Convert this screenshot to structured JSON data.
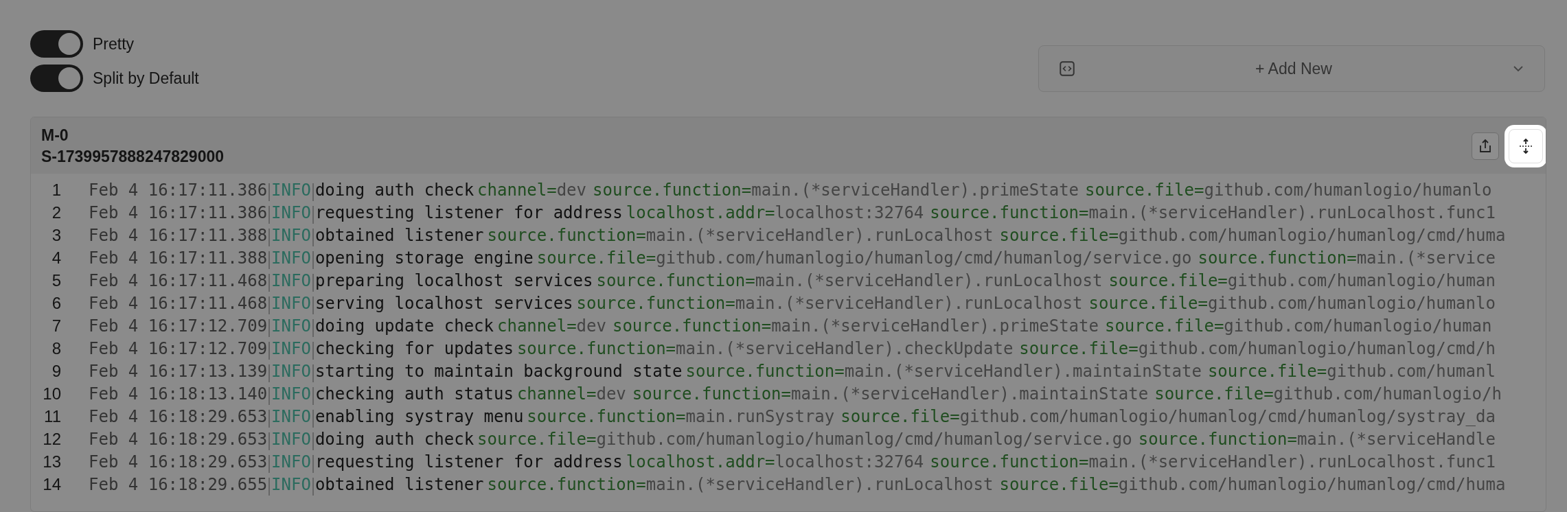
{
  "toggles": [
    {
      "label": "Pretty",
      "on": true
    },
    {
      "label": "Split by Default",
      "on": true
    }
  ],
  "add_new": {
    "label": "+ Add New"
  },
  "panel": {
    "title": "M-0",
    "subtitle": "S-1739957888247829000",
    "buttons": [
      {
        "kind": "share",
        "highlighted": false
      },
      {
        "kind": "expand",
        "highlighted": true
      }
    ],
    "rows": [
      {
        "line": "1",
        "timestamp": "Feb 4 16:17:11.386",
        "level": "INFO",
        "message": "doing auth check",
        "fields": [
          {
            "key": "channel=",
            "value": "dev"
          },
          {
            "key": "source.function=",
            "value": "main.(*serviceHandler).primeState"
          },
          {
            "key": "source.file=",
            "value": "github.com/humanlogio/humanlo"
          }
        ]
      },
      {
        "line": "2",
        "timestamp": "Feb 4 16:17:11.386",
        "level": "INFO",
        "message": "requesting listener for address",
        "fields": [
          {
            "key": "localhost.addr=",
            "value": "localhost:32764"
          },
          {
            "key": "source.function=",
            "value": "main.(*serviceHandler).runLocalhost.func1"
          }
        ]
      },
      {
        "line": "3",
        "timestamp": "Feb 4 16:17:11.388",
        "level": "INFO",
        "message": "obtained listener",
        "fields": [
          {
            "key": "source.function=",
            "value": "main.(*serviceHandler).runLocalhost"
          },
          {
            "key": "source.file=",
            "value": "github.com/humanlogio/humanlog/cmd/huma"
          }
        ]
      },
      {
        "line": "4",
        "timestamp": "Feb 4 16:17:11.388",
        "level": "INFO",
        "message": "opening storage engine",
        "fields": [
          {
            "key": "source.file=",
            "value": "github.com/humanlogio/humanlog/cmd/humanlog/service.go"
          },
          {
            "key": "source.function=",
            "value": "main.(*service"
          }
        ]
      },
      {
        "line": "5",
        "timestamp": "Feb 4 16:17:11.468",
        "level": "INFO",
        "message": "preparing localhost services",
        "fields": [
          {
            "key": "source.function=",
            "value": "main.(*serviceHandler).runLocalhost"
          },
          {
            "key": "source.file=",
            "value": "github.com/humanlogio/human"
          }
        ]
      },
      {
        "line": "6",
        "timestamp": "Feb 4 16:17:11.468",
        "level": "INFO",
        "message": "serving localhost services",
        "fields": [
          {
            "key": "source.function=",
            "value": "main.(*serviceHandler).runLocalhost"
          },
          {
            "key": "source.file=",
            "value": "github.com/humanlogio/humanlo"
          }
        ]
      },
      {
        "line": "7",
        "timestamp": "Feb 4 16:17:12.709",
        "level": "INFO",
        "message": "doing update check",
        "fields": [
          {
            "key": "channel=",
            "value": "dev"
          },
          {
            "key": "source.function=",
            "value": "main.(*serviceHandler).primeState"
          },
          {
            "key": "source.file=",
            "value": "github.com/humanlogio/human"
          }
        ]
      },
      {
        "line": "8",
        "timestamp": "Feb 4 16:17:12.709",
        "level": "INFO",
        "message": "checking for updates",
        "fields": [
          {
            "key": "source.function=",
            "value": "main.(*serviceHandler).checkUpdate"
          },
          {
            "key": "source.file=",
            "value": "github.com/humanlogio/humanlog/cmd/h"
          }
        ]
      },
      {
        "line": "9",
        "timestamp": "Feb 4 16:17:13.139",
        "level": "INFO",
        "message": "starting to maintain background state",
        "fields": [
          {
            "key": "source.function=",
            "value": "main.(*serviceHandler).maintainState"
          },
          {
            "key": "source.file=",
            "value": "github.com/humanl"
          }
        ]
      },
      {
        "line": "10",
        "timestamp": "Feb 4 16:18:13.140",
        "level": "INFO",
        "message": "checking auth status",
        "fields": [
          {
            "key": "channel=",
            "value": "dev"
          },
          {
            "key": "source.function=",
            "value": "main.(*serviceHandler).maintainState"
          },
          {
            "key": "source.file=",
            "value": "github.com/humanlogio/h"
          }
        ]
      },
      {
        "line": "11",
        "timestamp": "Feb 4 16:18:29.653",
        "level": "INFO",
        "message": "enabling systray menu",
        "fields": [
          {
            "key": "source.function=",
            "value": "main.runSystray"
          },
          {
            "key": "source.file=",
            "value": "github.com/humanlogio/humanlog/cmd/humanlog/systray_da"
          }
        ]
      },
      {
        "line": "12",
        "timestamp": "Feb 4 16:18:29.653",
        "level": "INFO",
        "message": "doing auth check",
        "fields": [
          {
            "key": "source.file=",
            "value": "github.com/humanlogio/humanlog/cmd/humanlog/service.go"
          },
          {
            "key": "source.function=",
            "value": "main.(*serviceHandle"
          }
        ]
      },
      {
        "line": "13",
        "timestamp": "Feb 4 16:18:29.653",
        "level": "INFO",
        "message": "requesting listener for address",
        "fields": [
          {
            "key": "localhost.addr=",
            "value": "localhost:32764"
          },
          {
            "key": "source.function=",
            "value": "main.(*serviceHandler).runLocalhost.func1"
          }
        ]
      },
      {
        "line": "14",
        "timestamp": "Feb 4 16:18:29.655",
        "level": "INFO",
        "message": "obtained listener",
        "fields": [
          {
            "key": "source.function=",
            "value": "main.(*serviceHandler).runLocalhost"
          },
          {
            "key": "source.file=",
            "value": "github.com/humanlogio/humanlog/cmd/huma"
          }
        ]
      }
    ]
  }
}
